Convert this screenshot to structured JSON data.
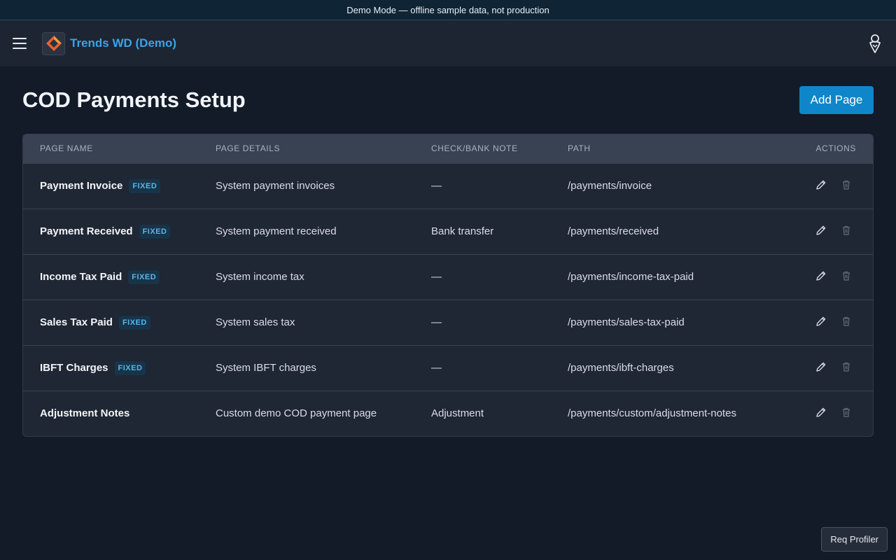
{
  "banner": {
    "text": "Demo Mode — offline sample data, not production"
  },
  "topbar": {
    "menu_icon": "hamburger-menu-icon",
    "app_title": "Trends WD (Demo)",
    "user_icon": "user-avatar-icon"
  },
  "page": {
    "title": "COD Payments Setup",
    "add_button": "Add Page"
  },
  "table": {
    "headers": {
      "page_name": "PAGE NAME",
      "page_details": "PAGE DETAILS",
      "check_bank_note": "CHECK/BANK NOTE",
      "path": "PATH",
      "actions": "ACTIONS"
    },
    "rows": [
      {
        "name": "Payment Invoice",
        "badge": "FIXED",
        "details": "System payment invoices",
        "note": "—",
        "path": "/payments/invoice"
      },
      {
        "name": "Payment Received",
        "badge": "FIXED",
        "details": "System payment received",
        "note": "Bank transfer",
        "path": "/payments/received"
      },
      {
        "name": "Income Tax Paid",
        "badge": "FIXED",
        "details": "System income tax",
        "note": "—",
        "path": "/payments/income-tax-paid"
      },
      {
        "name": "Sales Tax Paid",
        "badge": "FIXED",
        "details": "System sales tax",
        "note": "—",
        "path": "/payments/sales-tax-paid"
      },
      {
        "name": "IBFT Charges",
        "badge": "FIXED",
        "details": "System IBFT charges",
        "note": "—",
        "path": "/payments/ibft-charges"
      },
      {
        "name": "Adjustment Notes",
        "badge": "",
        "details": "Custom demo COD payment page",
        "note": "Adjustment",
        "path": "/payments/custom/adjustment-notes"
      }
    ],
    "action_icons": [
      "pencil-edit-icon",
      "trash-delete-icon"
    ]
  },
  "footer": {
    "profiler_button": "Req Profiler"
  },
  "colors": {
    "accent": "#0f86c9",
    "title_blue": "#3aa3e8",
    "badge_text": "#5cb3e6",
    "background": "#131a28"
  }
}
